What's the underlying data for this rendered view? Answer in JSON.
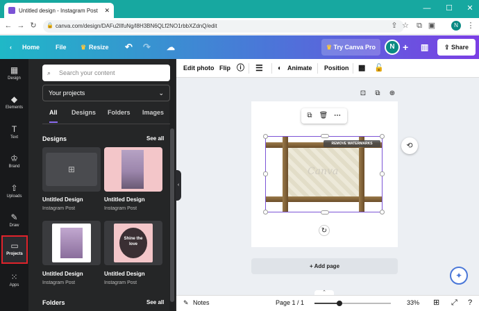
{
  "browser": {
    "tab_title": "Untitled design - Instagram Post",
    "url": "canva.com/design/DAFu2lIfuNg/l8H3BN6QLf2NO1rbbXZdnQ/edit",
    "new_tab": "+"
  },
  "header": {
    "home": "Home",
    "file": "File",
    "resize": "Resize",
    "try_pro": "Try Canva Pro",
    "avatar_initial": "N",
    "share": "Share"
  },
  "rail": {
    "items": [
      {
        "label": "Design",
        "icon": "layout-icon"
      },
      {
        "label": "Elements",
        "icon": "shapes-icon"
      },
      {
        "label": "Text",
        "icon": "text-icon"
      },
      {
        "label": "Brand",
        "icon": "brand-icon"
      },
      {
        "label": "Uploads",
        "icon": "cloud-upload-icon"
      },
      {
        "label": "Draw",
        "icon": "pen-icon"
      },
      {
        "label": "Projects",
        "icon": "folder-icon"
      },
      {
        "label": "Apps",
        "icon": "grid-icon"
      }
    ]
  },
  "panel": {
    "search_placeholder": "Search your content",
    "project_select": "Your projects",
    "tabs": [
      "All",
      "Designs",
      "Folders",
      "Images"
    ],
    "designs_heading": "Designs",
    "see_all": "See all",
    "cards": [
      {
        "name": "Untitled Design",
        "sub": "Instagram Post"
      },
      {
        "name": "Untitled Design",
        "sub": "Instagram Post"
      },
      {
        "name": "Untitled Design",
        "sub": "Instagram Post"
      },
      {
        "name": "Untitled Design",
        "sub": "Instagram Post"
      }
    ],
    "folders_heading": "Folders",
    "folders_see_all": "See all",
    "card_text": "Shine the love"
  },
  "toolbar": {
    "edit_photo": "Edit photo",
    "flip": "Flip",
    "animate": "Animate",
    "position": "Position"
  },
  "canvas": {
    "watermark": "REMOVE WATERMARKS",
    "canva_logo": "Canva",
    "add_page": "+ Add page"
  },
  "footer": {
    "notes": "Notes",
    "page": "Page 1 / 1",
    "zoom": "33%",
    "zoom_level": 0.33
  },
  "colors": {
    "accent": "#8b6cf0",
    "highlight_box": "#e1232b",
    "frame_wood": "#8a6a3e"
  }
}
